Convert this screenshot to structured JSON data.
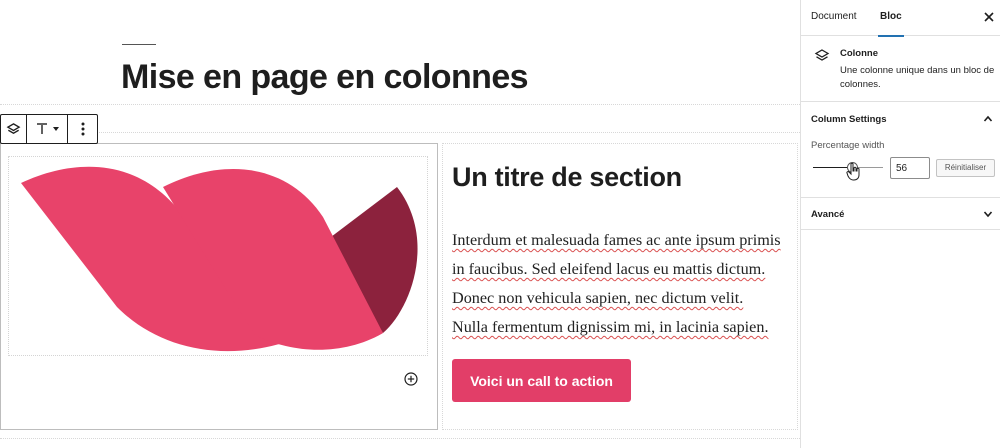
{
  "editor": {
    "page_title": "Mise en page en colonnes",
    "section_heading": "Un titre de section",
    "paragraph_lines": [
      "Interdum et malesuada fames ac ante ipsum primis",
      "in faucibus. Sed eleifend lacus eu mattis dictum.",
      "Donec non vehicula sapien, nec dictum velit.",
      "Nulla fermentum dignissim mi, in lacinia sapien."
    ],
    "cta_label": "Voici un call to action",
    "logo_colors": {
      "primary": "#e8436a",
      "dark": "#8c223d"
    },
    "toolbar_icons": [
      "layers-icon",
      "align-top-icon",
      "more-vertical-icon"
    ]
  },
  "sidebar": {
    "tabs": [
      "Document",
      "Bloc"
    ],
    "active_tab": "Bloc",
    "block": {
      "name": "Colonne",
      "description": "Une colonne unique dans un bloc de colonnes."
    },
    "column_settings": {
      "title": "Column Settings",
      "percentage_label": "Percentage width",
      "percentage_value": "56",
      "range_fraction": 0.56,
      "reset_label": "Réinitialiser"
    },
    "advanced": {
      "title": "Avancé"
    }
  },
  "colors": {
    "accent": "#2271b1",
    "cta": "#e23e68"
  }
}
